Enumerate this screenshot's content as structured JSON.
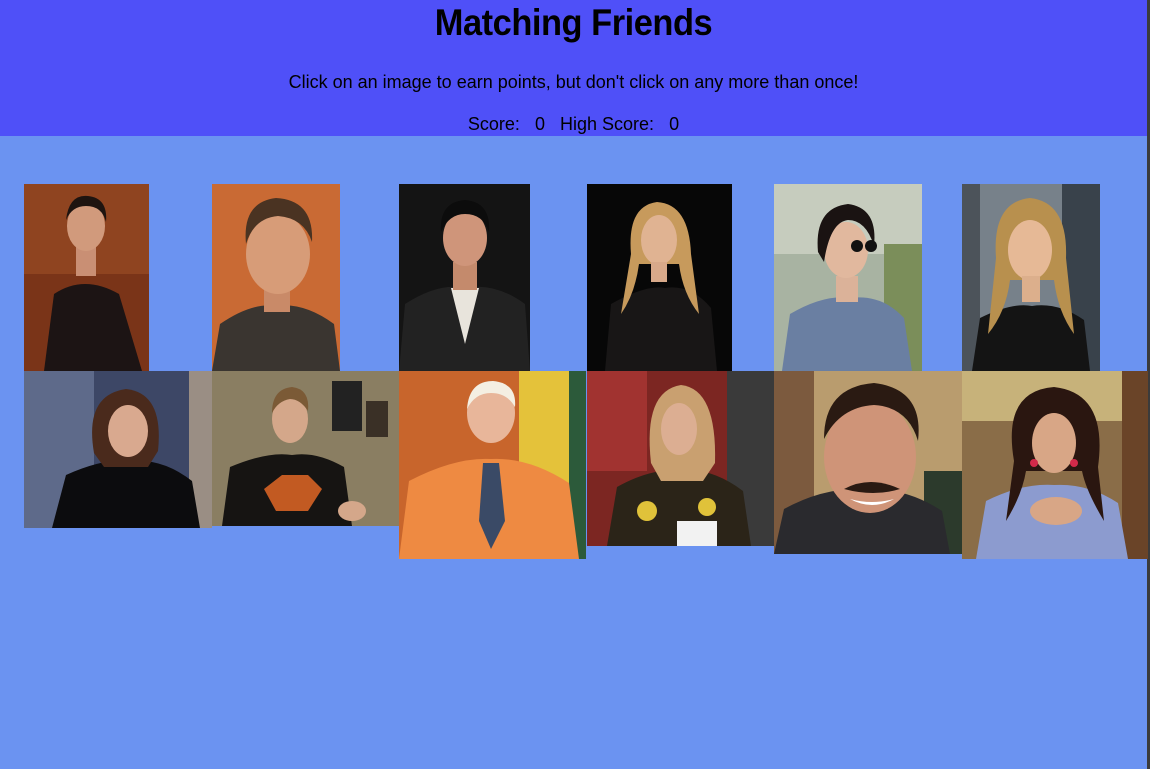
{
  "header": {
    "title": "Matching Friends",
    "instructions": "Click on an image to earn points, but don't click on any more than once!",
    "score_label": "Score:",
    "score_value": "0",
    "high_score_label": "High Score:",
    "high_score_value": "0"
  },
  "colors": {
    "header_bg": "#4f50f8",
    "page_bg": "#6b93f1"
  },
  "cards": [
    {
      "name": "ross-photo"
    },
    {
      "name": "chandler-photo"
    },
    {
      "name": "joey-photo"
    },
    {
      "name": "phoebe-photo"
    },
    {
      "name": "monica-photo"
    },
    {
      "name": "rachel-photo"
    },
    {
      "name": "julie-photo"
    },
    {
      "name": "eddie-photo"
    },
    {
      "name": "gunther-photo"
    },
    {
      "name": "emily-photo"
    },
    {
      "name": "richard-photo"
    },
    {
      "name": "janice-photo"
    }
  ]
}
